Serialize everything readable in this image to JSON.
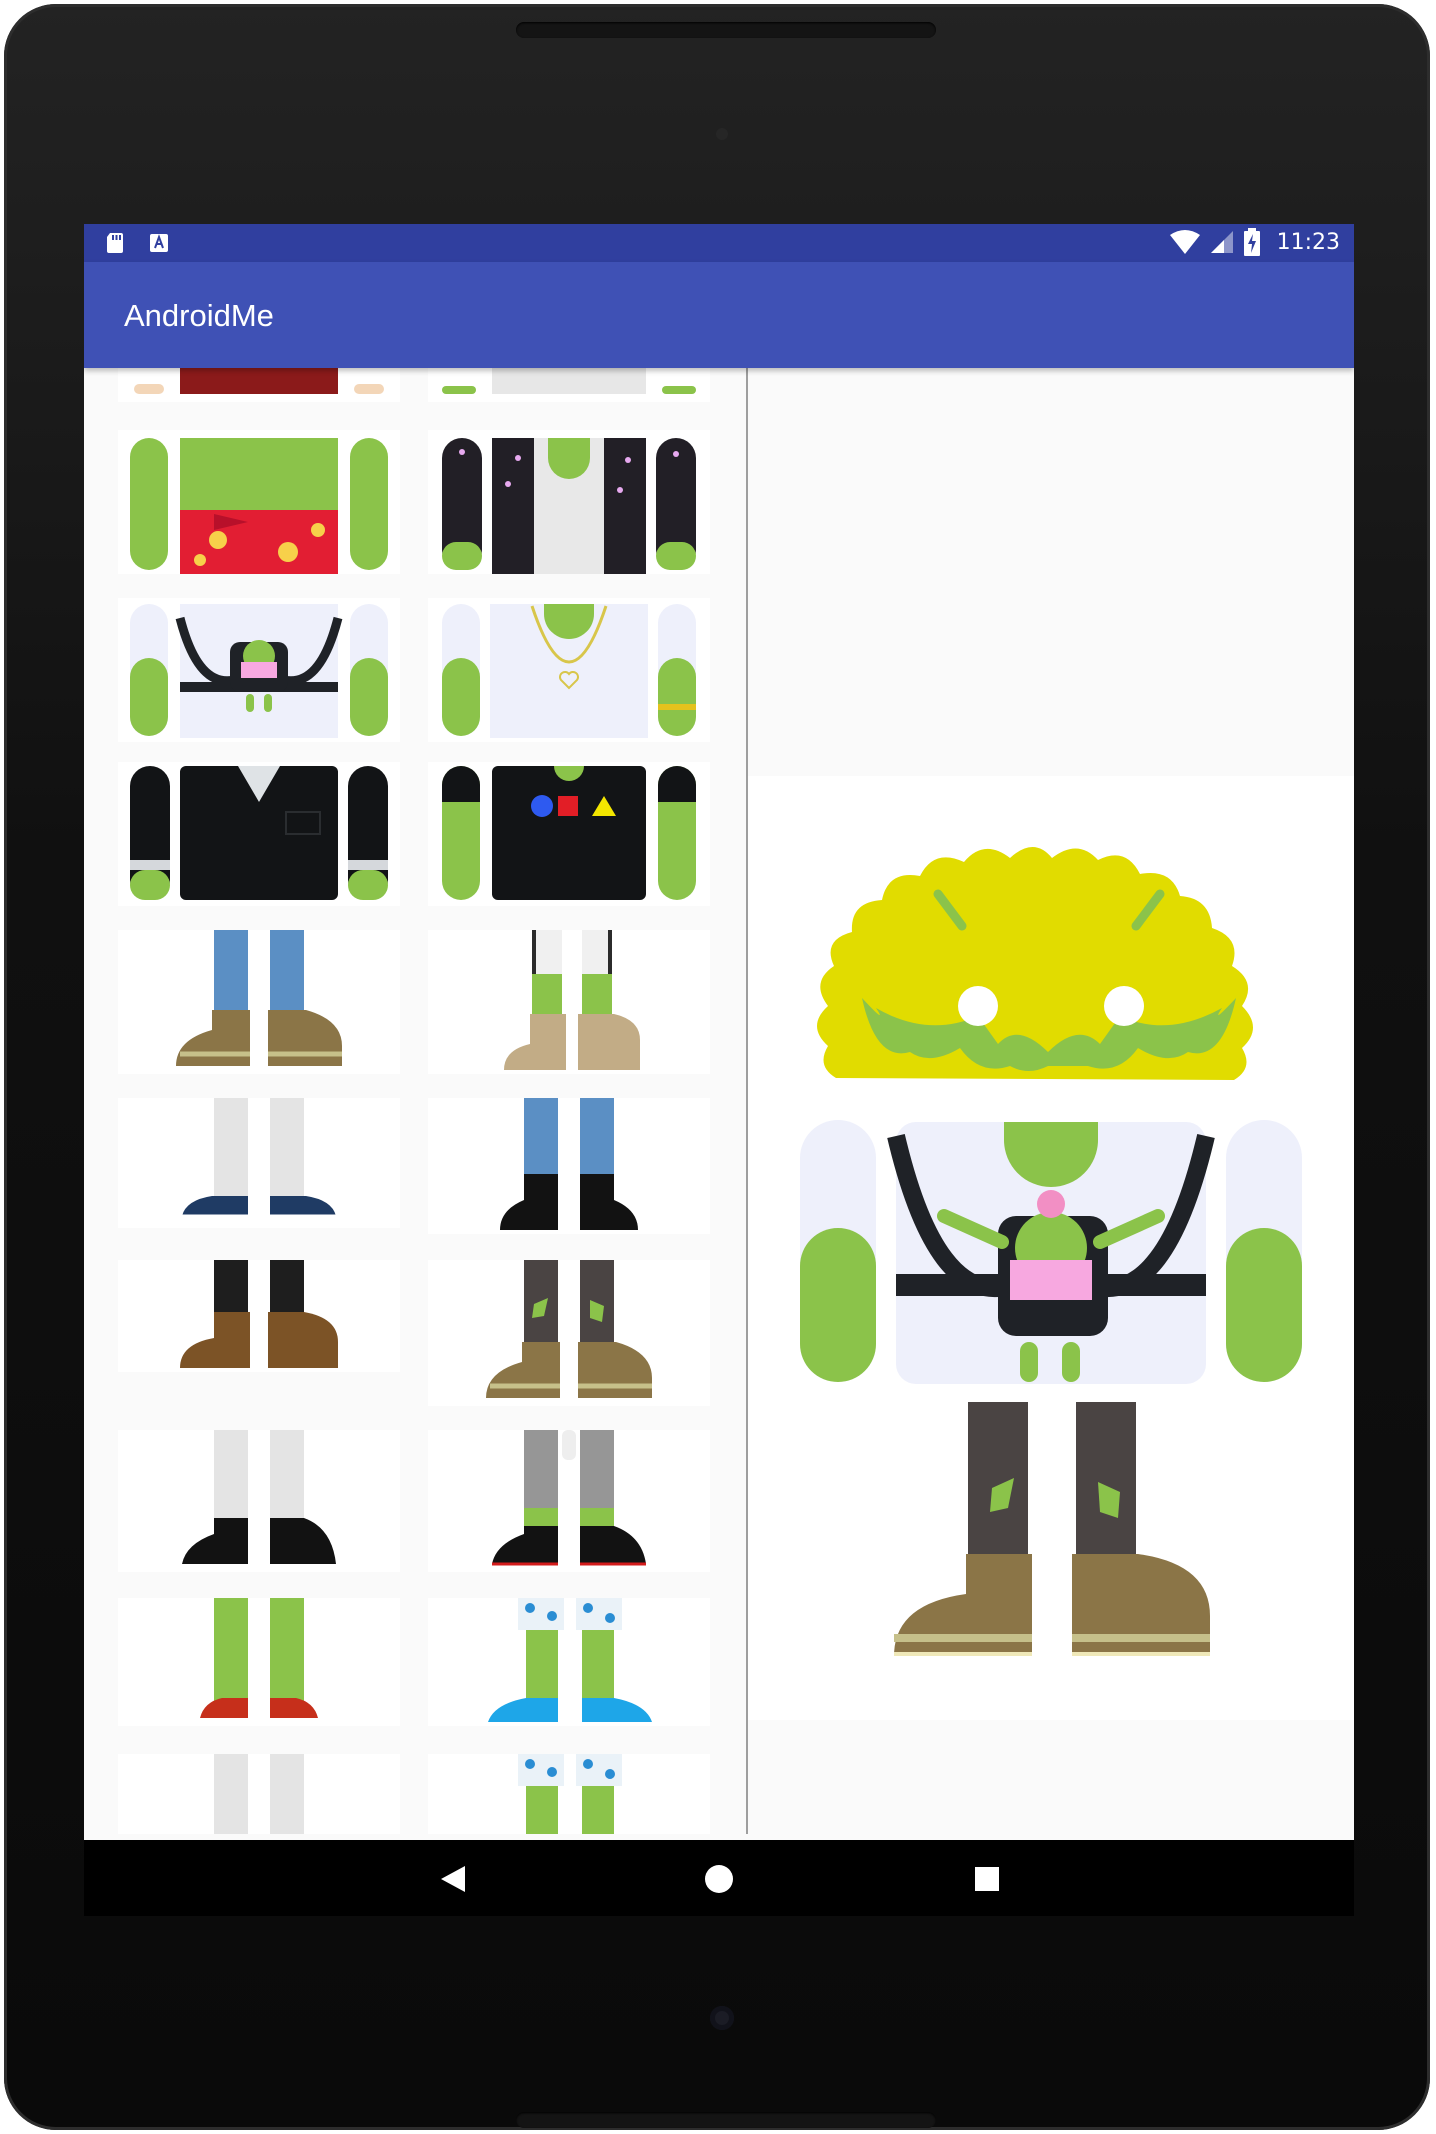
{
  "app": {
    "title": "AndroidMe",
    "status_time": "11:23"
  },
  "status_icons": [
    "sd-card-icon",
    "keyboard-a-icon",
    "wifi-icon",
    "signal-icon",
    "battery-charging-icon"
  ],
  "colors": {
    "status_bar": "#303f9f",
    "toolbar": "#3f51b5",
    "android_green": "#8bc34a",
    "background": "#fafafa",
    "hair_yellow": "#e1dc00"
  },
  "navigation": {
    "buttons": [
      "back-icon",
      "home-icon",
      "recents-icon"
    ]
  }
}
